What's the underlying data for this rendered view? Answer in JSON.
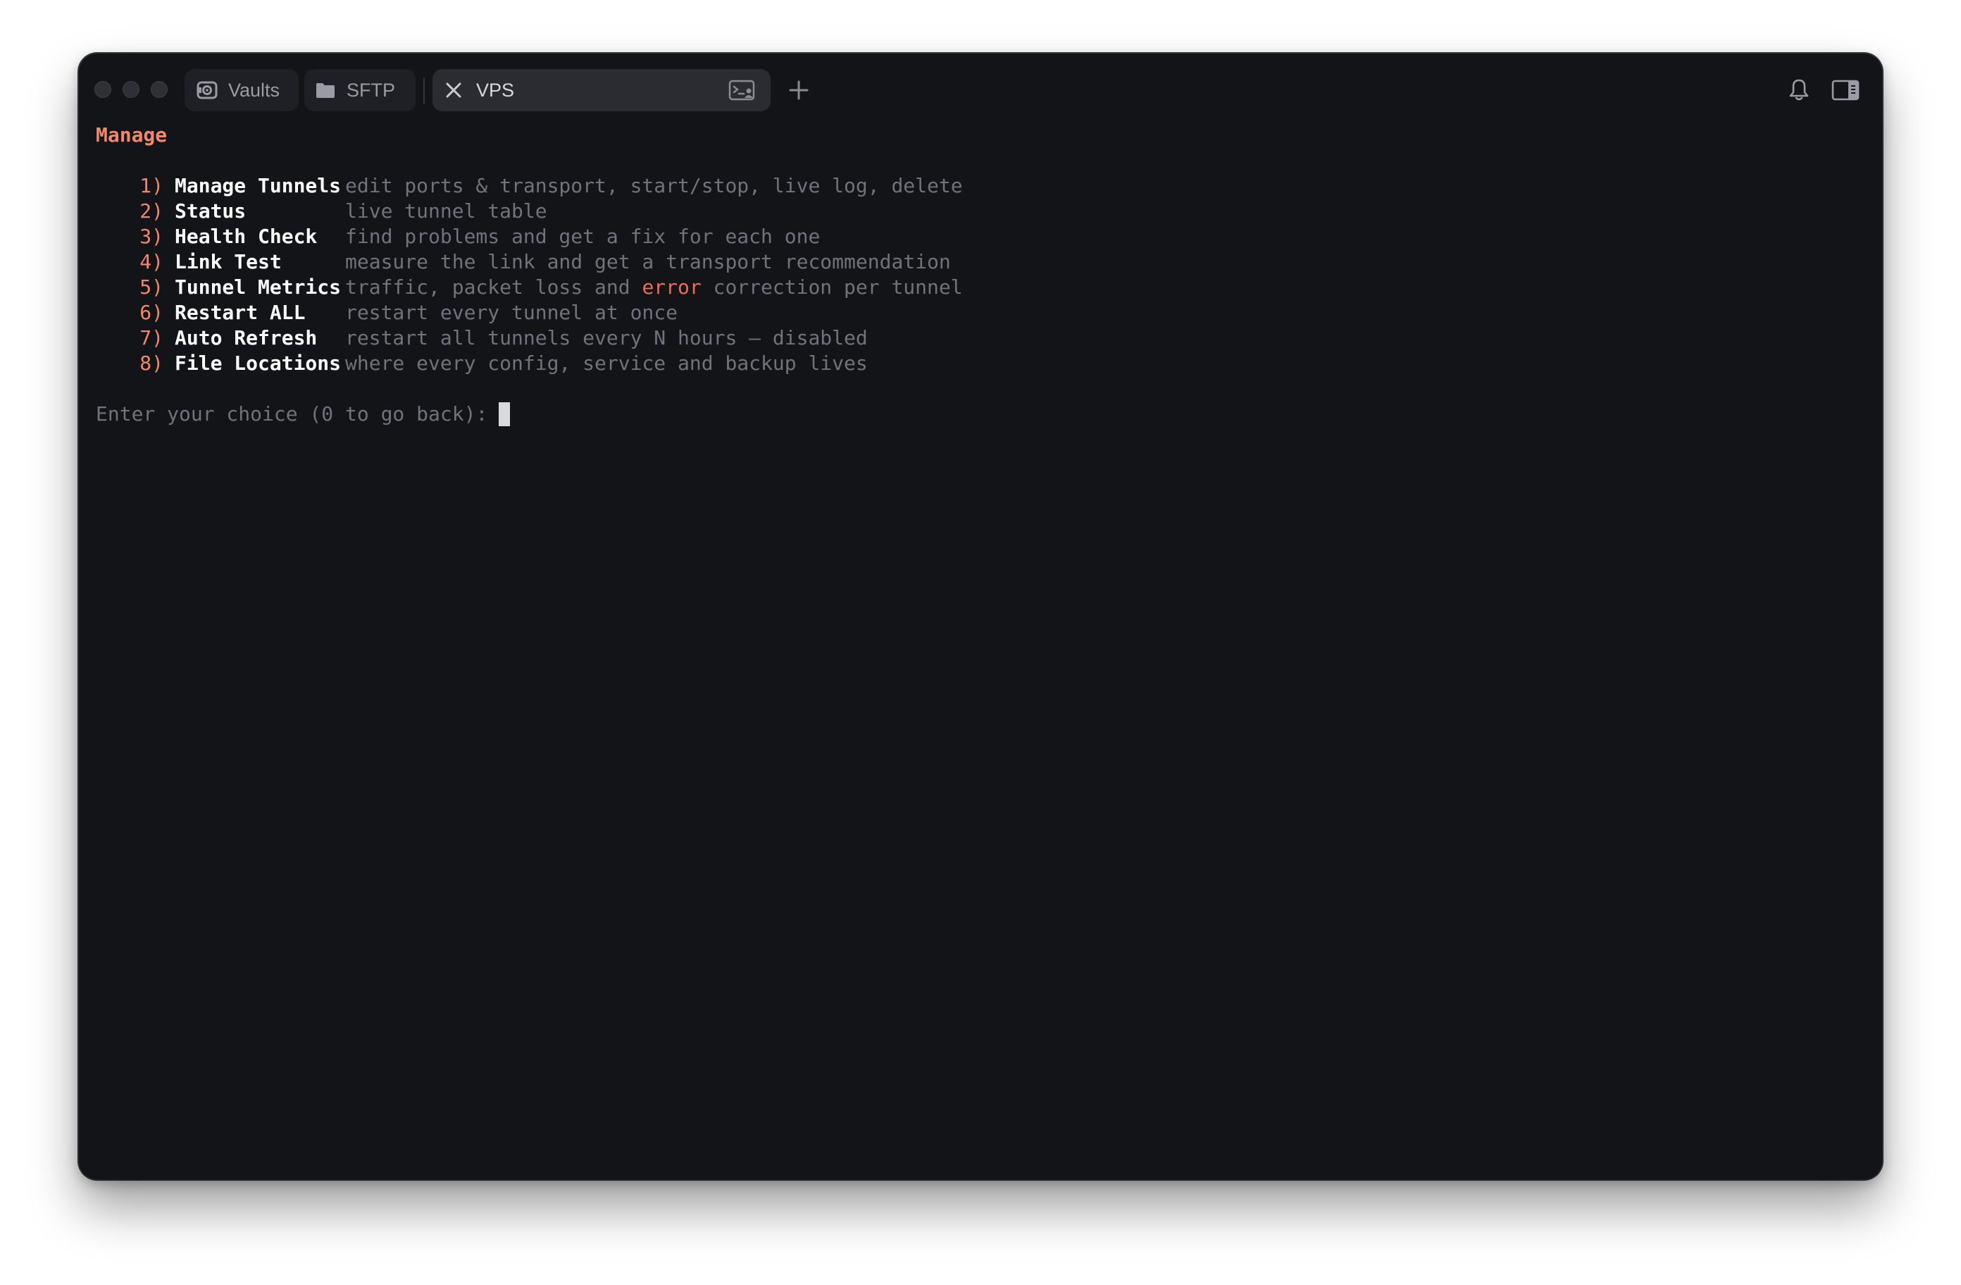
{
  "tabs": [
    {
      "label": "Vaults",
      "icon": "vault-icon"
    },
    {
      "label": "SFTP",
      "icon": "folder-icon"
    },
    {
      "label": "VPS",
      "icon": "close-icon",
      "secondary_icon": "terminal-icon",
      "active": true
    }
  ],
  "toolbar": {
    "new_tab_icon": "plus-icon",
    "notifications_icon": "bell-icon",
    "sidebar_icon": "sidebar-toggle-icon"
  },
  "terminal": {
    "heading": "Manage",
    "menu": [
      {
        "num": "1)",
        "label": "Manage Tunnels",
        "desc": "edit ports & transport, start/stop, live log, delete"
      },
      {
        "num": "2)",
        "label": "Status",
        "desc": "live tunnel table"
      },
      {
        "num": "3)",
        "label": "Health Check",
        "desc": "find problems and get a fix for each one"
      },
      {
        "num": "4)",
        "label": "Link Test",
        "desc": "measure the link and get a transport recommendation"
      },
      {
        "num": "5)",
        "label": "Tunnel Metrics",
        "desc_before": "traffic, packet loss and ",
        "desc_highlight": "error",
        "desc_after": " correction per tunnel"
      },
      {
        "num": "6)",
        "label": "Restart ALL",
        "desc": "restart every tunnel at once"
      },
      {
        "num": "7)",
        "label": "Auto Refresh",
        "desc": "restart all tunnels every N hours — disabled"
      },
      {
        "num": "8)",
        "label": "File Locations",
        "desc": "where every config, service and backup lives"
      }
    ],
    "prompt": "Enter your choice (0 to go back):"
  },
  "colors": {
    "background": "#121418",
    "accent": "#f2876a",
    "error": "#f06b5a",
    "muted": "#6f737b"
  }
}
